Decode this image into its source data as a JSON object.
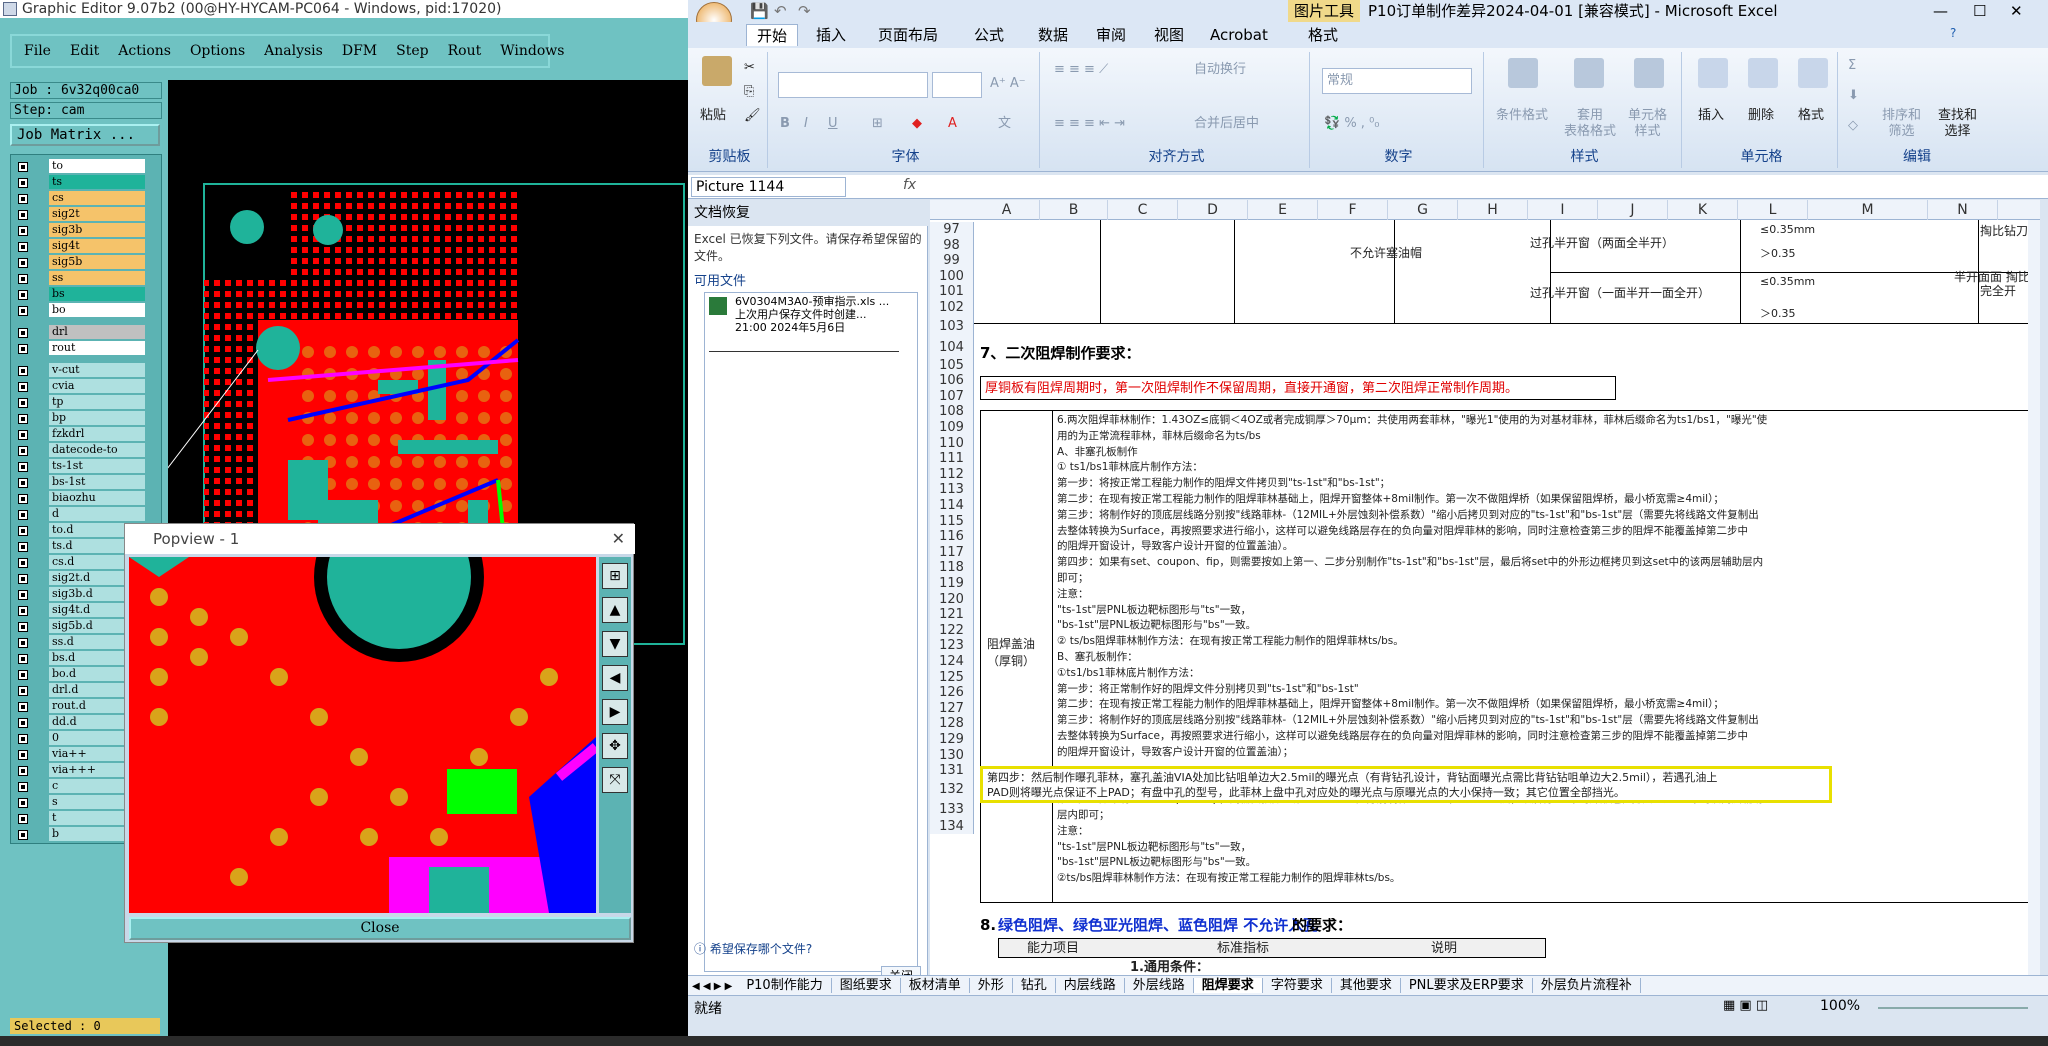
{
  "ge": {
    "title": "Graphic Editor 9.07b2 (00@HY-HYCAM-PC064 - Windows, pid:17020)",
    "menu": [
      "File",
      "Edit",
      "Actions",
      "Options",
      "Analysis",
      "DFM",
      "Step",
      "Rout",
      "Windows"
    ],
    "job": "Job : 6v32q00ca0",
    "step": "Step: cam",
    "job_matrix": "Job Matrix ...",
    "layers": [
      {
        "name": "to",
        "color": "#ffffff"
      },
      {
        "name": "ts",
        "color": "#1fb39a"
      },
      {
        "name": "cs",
        "color": "#f5c36a"
      },
      {
        "name": "sig2t",
        "color": "#f5c36a"
      },
      {
        "name": "sig3b",
        "color": "#f5c36a"
      },
      {
        "name": "sig4t",
        "color": "#f5c36a"
      },
      {
        "name": "sig5b",
        "color": "#f5c36a"
      },
      {
        "name": "ss",
        "color": "#f5c36a"
      },
      {
        "name": "bs",
        "color": "#1fb39a"
      },
      {
        "name": "bo",
        "color": "#ffffff"
      },
      {
        "name": "drl",
        "color": "#c0c0c0"
      },
      {
        "name": "rout",
        "color": "#ffffff"
      },
      {
        "name": "v-cut",
        "color": "#aee0e0"
      },
      {
        "name": "cvia",
        "color": "#aee0e0"
      },
      {
        "name": "tp",
        "color": "#aee0e0"
      },
      {
        "name": "bp",
        "color": "#aee0e0"
      },
      {
        "name": "fzkdrl",
        "color": "#aee0e0"
      },
      {
        "name": "datecode-to",
        "color": "#aee0e0"
      },
      {
        "name": "ts-1st",
        "color": "#aee0e0"
      },
      {
        "name": "bs-1st",
        "color": "#aee0e0"
      },
      {
        "name": "biaozhu",
        "color": "#aee0e0"
      },
      {
        "name": "d",
        "color": "#aee0e0"
      },
      {
        "name": "to.d",
        "color": "#aee0e0"
      },
      {
        "name": "ts.d",
        "color": "#aee0e0"
      },
      {
        "name": "cs.d",
        "color": "#aee0e0"
      },
      {
        "name": "sig2t.d",
        "color": "#aee0e0"
      },
      {
        "name": "sig3b.d",
        "color": "#aee0e0"
      },
      {
        "name": "sig4t.d",
        "color": "#aee0e0"
      },
      {
        "name": "sig5b.d",
        "color": "#aee0e0"
      },
      {
        "name": "ss.d",
        "color": "#aee0e0"
      },
      {
        "name": "bs.d",
        "color": "#aee0e0"
      },
      {
        "name": "bo.d",
        "color": "#aee0e0"
      },
      {
        "name": "drl.d",
        "color": "#aee0e0"
      },
      {
        "name": "rout.d",
        "color": "#aee0e0"
      },
      {
        "name": "dd.d",
        "color": "#aee0e0"
      },
      {
        "name": "0",
        "color": "#aee0e0"
      },
      {
        "name": "via++",
        "color": "#aee0e0"
      },
      {
        "name": "via+++",
        "color": "#aee0e0"
      },
      {
        "name": "c",
        "color": "#aee0e0"
      },
      {
        "name": "s",
        "color": "#aee0e0"
      },
      {
        "name": "t",
        "color": "#aee0e0"
      },
      {
        "name": "b",
        "color": "#aee0e0"
      }
    ],
    "selected": "Selected : 0",
    "popview_title": "Popview - 1",
    "popview_close": "Close"
  },
  "xl": {
    "title": "P10订单制作差异2024-04-01 [兼容模式] - Microsoft Excel",
    "context_tab": "图片工具",
    "tabs": [
      "开始",
      "插入",
      "页面布局",
      "公式",
      "数据",
      "审阅",
      "视图",
      "Acrobat",
      "格式"
    ],
    "ribbon": {
      "paste": "粘贴",
      "clipboard": "剪贴板",
      "font": "字体",
      "align": "对齐方式",
      "number": "数字",
      "style": "样式",
      "cells": "单元格",
      "edit": "编辑",
      "wrap": "自动换行",
      "merge": "合并后居中",
      "numfmt": "常规",
      "cond": "条件格式",
      "table": "套用\n表格格式",
      "cellstyle": "单元格\n样式",
      "insert": "插入",
      "delete": "删除",
      "format": "格式",
      "sort": "排序和\n筛选",
      "find": "查找和\n选择"
    },
    "namebox": "Picture 1144",
    "fx": "fx",
    "recovery": {
      "head": "文档恢复",
      "desc": "Excel 已恢复下列文件。请保存希望保留的文件。",
      "avail": "可用文件",
      "file1": "6V0304M3A0-预审指示.xls ...",
      "file2": "上次用户保存文件时创建...",
      "file3": "21:00 2024年5月6日",
      "q": "希望保存哪个文件?",
      "close": "关闭"
    },
    "cols": [
      "A",
      "B",
      "C",
      "D",
      "E",
      "F",
      "G",
      "H",
      "I",
      "J",
      "K",
      "L",
      "M",
      "N"
    ],
    "rows": [
      "97",
      "98",
      "99",
      "100",
      "101",
      "102",
      "103",
      "104",
      "105",
      "106",
      "107",
      "108",
      "109",
      "110",
      "111",
      "112",
      "113",
      "114",
      "115",
      "116",
      "117",
      "118",
      "119",
      "120",
      "121",
      "122",
      "123",
      "124",
      "125",
      "126",
      "127",
      "128",
      "129",
      "130",
      "131",
      "132",
      "133",
      "134"
    ],
    "cells": {
      "g98": "不允许塞油帽",
      "i98": "过孔半开窗（两面全半开）",
      "l97": "≤0.35mm",
      "l98": "＞0.35",
      "n97": "掏比钻刀整",
      "i100": "过孔半开窗（一面半开一面全开）",
      "l100": "≤0.35mm",
      "l102": "＞0.35",
      "n100": "半开面面 掏比",
      "n101": "完全开",
      "r103": "7、二次阻焊制作要求：",
      "r104": "厚铜板有阻焊周期时，第一次阻焊制作不保留周期，直接开通窗，第二次阻焊正常制作周期。",
      "side": "阻焊盖油\n（厚铜）",
      "lines": [
        "6.两次阻焊菲林制作：1.43OZ≤底铜＜4OZ或者完成铜厚＞70μm：共使用两套菲林，\"曝光1\"使用的为对基材菲林，菲林后缀命名为ts1/bs1，\"曝光\"使",
        "用的为正常流程菲林，菲林后缀命名为ts/bs",
        "A、非塞孔板制作",
        "① ts1/bs1菲林底片制作方法：",
        "第一步：将按正常工程能力制作的阻焊文件拷贝到\"ts-1st\"和\"bs-1st\"；",
        "第二步：在现有按正常工程能力制作的阻焊菲林基础上，阻焊开窗整体+8mil制作。第一次不做阻焊桥（如果保留阻焊桥，最小桥宽需≥4mil）；",
        "第三步：将制作好的顶底层线路分别按\"线路菲林-（12MIL+外层蚀刻补偿系数）\"缩小后拷贝到对应的\"ts-1st\"和\"bs-1st\"层（需要先将线路文件复制出",
        "去整体转换为Surface，再按照要求进行缩小，这样可以避免线路层存在的负向量对阻焊菲林的影响，同时注意检查第三步的阻焊不能覆盖掉第二步中",
        "的阻焊开窗设计，导致客户设计开窗的位置盖油）。",
        "第四步：如果有set、coupon、fip，则需要按如上第一、二步分别制作\"ts-1st\"和\"bs-1st\"层，最后将set中的外形边框拷贝到这set中的该两层辅助层内",
        "即可；",
        "注意：",
        "\"ts-1st\"层PNL板边靶标图形与\"ts\"一致，",
        "\"bs-1st\"层PNL板边靶标图形与\"bs\"一致。",
        "② ts/bs阻焊菲林制作方法：在现有按正常工程能力制作的阻焊菲林ts/bs。",
        "B、塞孔板制作：",
        "①ts1/bs1菲林底片制作方法：",
        "第一步：将正常制作好的阻焊文件分别拷贝到\"ts-1st\"和\"bs-1st\"",
        "第二步：在现有按正常工程能力制作的阻焊菲林基础上，阻焊开窗整体+8mil制作。第一次不做阻焊桥（如果保留阻焊桥，最小桥宽需≥4mil）；",
        "第三步：将制作好的顶底层线路分别按\"线路菲林-（12MIL+外层蚀刻补偿系数）\"缩小后拷贝到对应的\"ts-1st\"和\"bs-1st\"层（需要先将线路文件复制出",
        "去整体转换为Surface，再按照要求进行缩小，这样可以避免线路层存在的负向量对阻焊菲林的影响，同时注意检查第三步的阻焊不能覆盖掉第二步中",
        "的阻焊开窗设计，导致客户设计开窗的位置盖油）；",
        "第四步：然后制作曝孔菲林，塞孔盖油VIA处加比钻咀单边大2.5mil的曝光点（有背钻孔设计，背钻面曝光点需比背钻钻咀单边大2.5mil），若遇孔油上",
        "PAD则将曝光点保证不上PAD；有盘中孔的型号，此菲林上盘中孔对应处的曝光点与原曝光点的大小保持一致；其它位置全部挡光。",
        "第五步：如果有set、coupon、fip，则需要按如上第一、二、三步分别制作\"ts-1st\"和\"bs-1st\"层，最后将set中的外形边框拷贝到这set中的该两层辅助",
        "层内即可；",
        "注意：",
        "\"ts-1st\"层PNL板边靶标图形与\"ts\"一致，",
        "\"bs-1st\"层PNL板边靶标图形与\"bs\"一致。",
        "②ts/bs阻焊菲林制作方法：在现有按正常工程能力制作的阻焊菲林ts/bs。"
      ],
      "r132a": "8.",
      "r132b": "绿色阻焊、绿色亚光阻焊、蓝色阻焊 不允许入孔",
      "r132c": "的要求：",
      "h133a": "能力项目",
      "h133b": "标准指标",
      "h133c": "说明",
      "r134": "1.通用条件："
    },
    "sheettabs": [
      "P10制作能力",
      "图纸要求",
      "板材清单",
      "外形",
      "钻孔",
      "内层线路",
      "外层线路",
      "阻焊要求",
      "字符要求",
      "其他要求",
      "PNL要求及ERP要求",
      "外层负片流程补"
    ],
    "status": "就绪",
    "zoom": "100%"
  }
}
